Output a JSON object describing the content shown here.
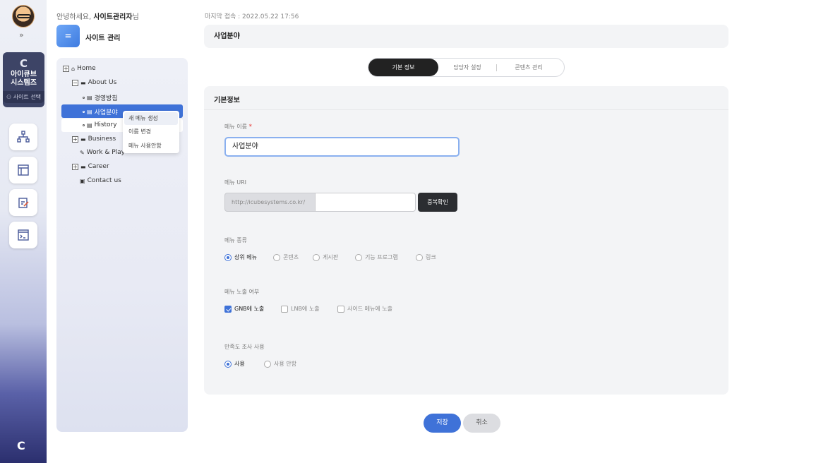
{
  "header": {
    "greeting_prefix": "안녕하세요, ",
    "user_name": "사이트관리자",
    "greeting_suffix": "님",
    "last_login": "마지막 접속 : 2022.05.22 17:56"
  },
  "rail": {
    "site_name_line1": "아이큐브",
    "site_name_line2": "시스템즈",
    "site_select": "사이트 선택"
  },
  "site_manage": {
    "title": "사이트 관리"
  },
  "tree": {
    "home": "Home",
    "about_us": "About Us",
    "item_policy": "경영방침",
    "item_business_field": "사업분야",
    "item_history": "History",
    "business": "Business",
    "work_play": "Work & Play",
    "career": "Career",
    "contact": "Contact us"
  },
  "context_menu": {
    "new_menu": "새 메뉴 생성",
    "rename": "이름 변경",
    "disable": "메뉴 사용안함"
  },
  "page": {
    "title": "사업분야",
    "tabs": [
      "기본 정보",
      "담당자 설정",
      "콘텐츠 관리"
    ]
  },
  "form": {
    "section_title": "기본정보",
    "menu_name_label": "메뉴 이름",
    "menu_name_required": "*",
    "menu_name_value": "사업분야",
    "menu_uri_label": "메뉴 URI",
    "menu_uri_prefix": "http://icubesystems.co.kr/",
    "dup_check": "중복확인",
    "menu_type_label": "메뉴 종류",
    "menu_types": [
      "상위 메뉴",
      "콘텐츠",
      "게시판",
      "기능 프로그램",
      "링크"
    ],
    "menu_type_selected": 0,
    "exposure_label": "메뉴 노출 여부",
    "exposures": [
      "GNB에 노출",
      "LNB에 노출",
      "사이드 메뉴에 노출"
    ],
    "exposure_checked": [
      true,
      false,
      false
    ],
    "survey_label": "만족도 조사 사용",
    "survey_options": [
      "사용",
      "사용 안함"
    ],
    "survey_selected": 0
  },
  "actions": {
    "save": "저장",
    "cancel": "취소"
  },
  "colors": {
    "accent": "#3f72d8",
    "dark_button": "#2b2d31"
  }
}
